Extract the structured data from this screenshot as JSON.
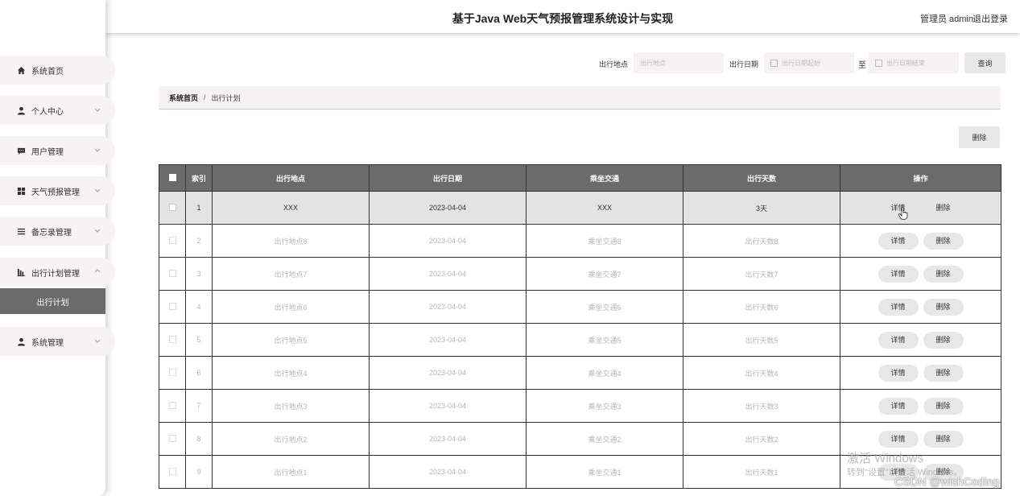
{
  "header": {
    "title": "基于Java Web天气预报管理系统设计与实现",
    "user": "管理员 admin",
    "logout": "退出登录"
  },
  "sidebar": {
    "items": [
      {
        "label": "系统首页",
        "icon": "home-icon"
      },
      {
        "label": "个人中心",
        "icon": "person-icon"
      },
      {
        "label": "用户管理",
        "icon": "chat-icon"
      },
      {
        "label": "天气预报管理",
        "icon": "grid-icon"
      },
      {
        "label": "备忘录管理",
        "icon": "list-icon"
      },
      {
        "label": "出行计划管理",
        "icon": "chart-icon"
      },
      {
        "label": "系统管理",
        "icon": "person-icon"
      }
    ],
    "sub_active": "出行计划"
  },
  "search": {
    "location_label": "出行地点",
    "location_placeholder": "出行地点",
    "date_label": "出行日期",
    "date_start_placeholder": "出行日期起始",
    "to_label": "至",
    "date_end_placeholder": "出行日期结束",
    "button": "查询"
  },
  "breadcrumb": {
    "home": "系统首页",
    "separator": "/",
    "current": "出行计划"
  },
  "delete_button": "删除",
  "table": {
    "headers": [
      "索引",
      "出行地点",
      "出行日期",
      "乘坐交通",
      "出行天数",
      "操作"
    ],
    "detail_label": "详情",
    "delete_label": "删除",
    "rows": [
      {
        "index": "1",
        "location": "XXX",
        "date": "2023-04-04",
        "transport": "XXX",
        "days": "3天"
      },
      {
        "index": "2",
        "location": "出行地点8",
        "date": "2023-04-04",
        "transport": "乘坐交通8",
        "days": "出行天数8"
      },
      {
        "index": "3",
        "location": "出行地点7",
        "date": "2023-04-04",
        "transport": "乘坐交通7",
        "days": "出行天数7"
      },
      {
        "index": "4",
        "location": "出行地点6",
        "date": "2023-04-04",
        "transport": "乘坐交通6",
        "days": "出行天数6"
      },
      {
        "index": "5",
        "location": "出行地点5",
        "date": "2023-04-04",
        "transport": "乘坐交通5",
        "days": "出行天数5"
      },
      {
        "index": "6",
        "location": "出行地点4",
        "date": "2023-04-04",
        "transport": "乘坐交通4",
        "days": "出行天数4"
      },
      {
        "index": "7",
        "location": "出行地点3",
        "date": "2023-04-04",
        "transport": "乘坐交通3",
        "days": "出行天数3"
      },
      {
        "index": "8",
        "location": "出行地点2",
        "date": "2023-04-04",
        "transport": "乘坐交通2",
        "days": "出行天数2"
      },
      {
        "index": "9",
        "location": "出行地点1",
        "date": "2023-04-04",
        "transport": "乘坐交通1",
        "days": "出行天数1"
      }
    ]
  },
  "watermark": {
    "line1": "激活 Windows",
    "line2": "转到\"设置\"以激活 Windows。",
    "csdn": "CSDN @wishCoding"
  },
  "colors": {
    "sidebar_active": "#6b6b6b",
    "table_header": "#6b6b6b",
    "row_active": "#e3e3e3"
  }
}
